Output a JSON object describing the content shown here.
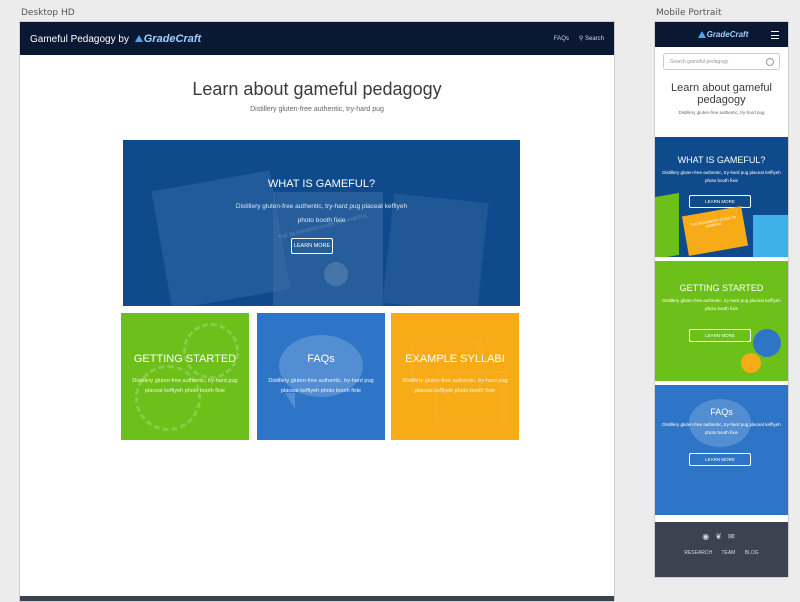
{
  "labels": {
    "desktop": "Desktop HD",
    "mobile": "Mobile Portrait"
  },
  "desktop": {
    "brand": "Gameful Pedagogy by",
    "logo": "GradeCraft",
    "nav": {
      "faqs": "FAQs",
      "search": "Search"
    },
    "heading": "Learn about gameful pedagogy",
    "subheading": "Distillery gluten-free authentic, try-hard pug",
    "hero": {
      "title": "WHAT IS GAMEFUL?",
      "text": "Distillery gluten-free authentic, try-hard pug placeat keffiyeh photo booth fixie",
      "button": "LEARN MORE",
      "ghost_text": "THE BEGINNERS GUIDE TO GAMEFUL"
    },
    "tiles": [
      {
        "title": "GETTING STARTED",
        "text": "Distillery gluten-free authentic, try-hard pug placeat keffiyeh photo booth fixie",
        "color": "#6cc019"
      },
      {
        "title": "FAQs",
        "text": "Distillery gluten-free authentic, try-hard pug placeat keffiyeh photo booth fixie",
        "color": "#2e75c8"
      },
      {
        "title": "EXAMPLE SYLLABI",
        "text": "Distillery gluten-free authentic, try-hard pug placeat keffiyeh photo booth fixie",
        "color": "#f7ab17"
      }
    ]
  },
  "mobile": {
    "logo": "GradeCraft",
    "search_placeholder": "Search gameful pedagogy",
    "heading": "Learn about gameful pedagogy",
    "subheading": "Distillery gluten-free authentic, try-hard pug",
    "tiles": [
      {
        "title": "WHAT IS GAMEFUL?",
        "text": "Distillery gluten-free authentic, try-hard pug placeat keffiyeh photo booth fixie",
        "button": "LEARN MORE",
        "color": "#0f4b8c",
        "book_text": "THE BEGINNERS GUIDE TO GAMEFUL"
      },
      {
        "title": "GETTING STARTED",
        "text": "Distillery gluten-free authentic, try-hard pug placeat keffiyeh photo booth fixie",
        "button": "LEARN MORE",
        "color": "#6cc019"
      },
      {
        "title": "FAQs",
        "text": "Distillery gluten-free authentic, try-hard pug placeat keffiyeh photo booth fixie",
        "button": "LEARN MORE",
        "color": "#2e75c8"
      }
    ],
    "footer": {
      "links": [
        "RESEARCH",
        "TEAM",
        "BLOG"
      ],
      "icons": [
        "github-icon",
        "twitter-icon",
        "mail-icon"
      ]
    }
  },
  "colors": {
    "nav": "#0b1833",
    "hero": "#0f4b8c",
    "green": "#6cc019",
    "blue": "#2e75c8",
    "orange": "#f7ab17"
  }
}
